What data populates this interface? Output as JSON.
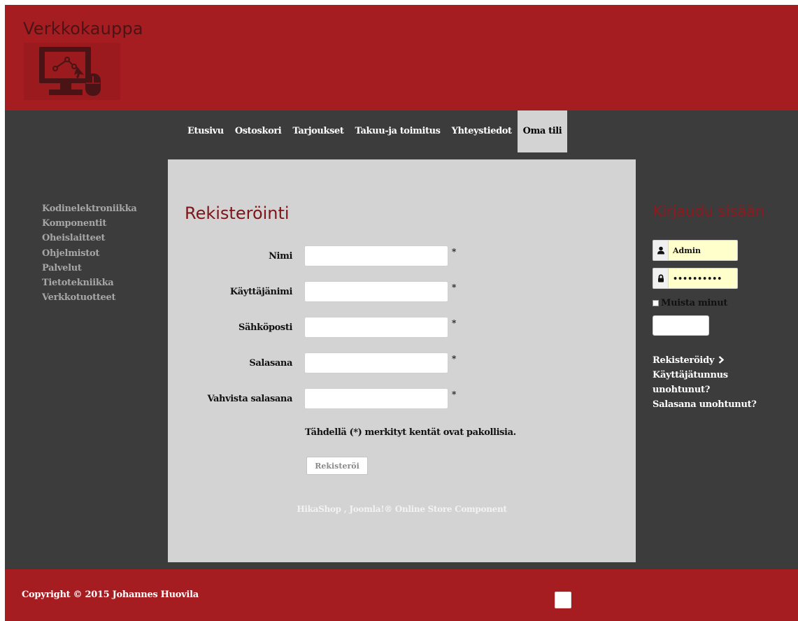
{
  "header": {
    "site_name": "Verkkokauppa",
    "logo_icon": "computer-mouse-logo"
  },
  "nav": {
    "items": [
      {
        "label": "Etusivu",
        "active": false
      },
      {
        "label": "Ostoskori",
        "active": false
      },
      {
        "label": "Tarjoukset",
        "active": false
      },
      {
        "label": "Takuu-ja toimitus",
        "active": false
      },
      {
        "label": "Yhteystiedot",
        "active": false
      },
      {
        "label": "Oma tili",
        "active": true
      }
    ]
  },
  "categories": {
    "items": [
      "Kodinelektroniikka",
      "Komponentit",
      "Oheislaitteet",
      "Ohjelmistot",
      "Palvelut",
      "Tietotekniikka",
      "Verkkotuotteet"
    ]
  },
  "registration": {
    "title": "Rekisteröinti",
    "fields": [
      {
        "label": "Nimi",
        "value": "",
        "required_mark": "*"
      },
      {
        "label": "Käyttäjänimi",
        "value": "",
        "required_mark": "*"
      },
      {
        "label": "Sähköposti",
        "value": "",
        "required_mark": "*"
      },
      {
        "label": "Salasana",
        "value": "",
        "required_mark": "*"
      },
      {
        "label": "Vahvista salasana",
        "value": "",
        "required_mark": "*"
      }
    ],
    "required_note": "Tähdellä (*) merkityt kentät ovat pakollisia.",
    "submit_label": "Rekisteröi",
    "powered_by": "HikaShop , Joomla!® Online Store Component"
  },
  "login": {
    "title": "Kirjaudu sisään",
    "username_value": "Admin",
    "password_value": "••••••••••",
    "username_icon": "user-icon",
    "password_icon": "lock-icon",
    "remember_label": "Muista minut",
    "remember_checked": false,
    "button_label": "",
    "links": [
      "Rekisteröidy",
      "Käyttäjätunnus unohtunut?",
      "Salasana unohtunut?"
    ],
    "register_icon": "chevron-right-icon"
  },
  "footer": {
    "copyright": "Copyright © 2015 Johannes Huovila",
    "top_button_label": ""
  },
  "colors": {
    "brand_red": "#a51d21",
    "dark_bg": "#3c3c3c",
    "panel_bg": "#d3d3d3",
    "title_red": "#7d1519",
    "input_highlight": "#ffffcc"
  }
}
